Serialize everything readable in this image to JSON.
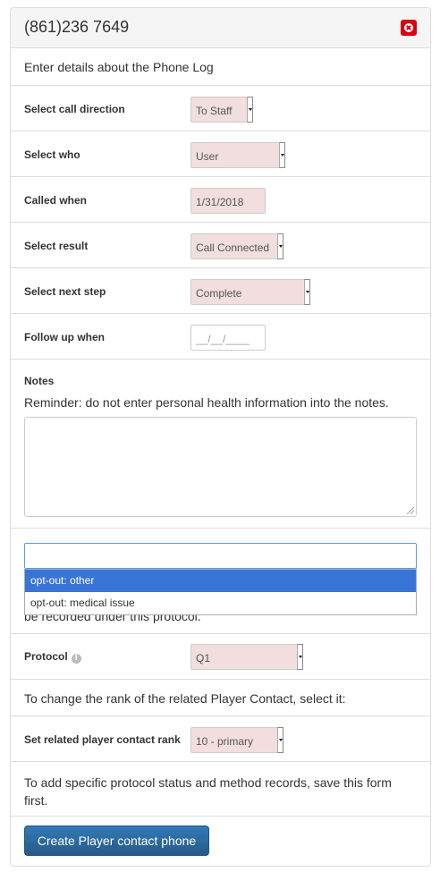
{
  "header": {
    "title": "(861)236 7649",
    "close_icon": "close-icon"
  },
  "intro": "Enter details about the Phone Log",
  "fields": {
    "call_direction": {
      "label": "Select call direction",
      "value": "To Staff"
    },
    "who": {
      "label": "Select who",
      "value": "User"
    },
    "called_when": {
      "label": "Called when",
      "value": "1/31/2018"
    },
    "result": {
      "label": "Select result",
      "value": "Call Connected"
    },
    "next_step": {
      "label": "Select next step",
      "value": "Complete"
    },
    "follow_up": {
      "label": "Follow up when",
      "placeholder": "__/__/____"
    }
  },
  "notes": {
    "label": "Notes",
    "reminder": "Reminder: do not enter personal health information into the notes."
  },
  "dropdown": {
    "search_value": "",
    "options": [
      "opt-out: other",
      "opt-out: medical issue"
    ],
    "highlighted_index": 0
  },
  "protocol_note": "be recorded under this protocol.",
  "protocol": {
    "label": "Protocol",
    "value": "Q1",
    "info_icon": "info-icon"
  },
  "rank_note": "To change the rank of the related Player Contact, select it:",
  "rank": {
    "label": "Set related player contact rank",
    "value": "10 - primary"
  },
  "save_note": "To add specific protocol status and method records, save this form first.",
  "submit_label": "Create Player contact phone",
  "colors": {
    "required_field_bg": "#f2dede",
    "primary_button": "#337ab7",
    "close_button": "#d9000f",
    "highlight": "#3875d7"
  }
}
